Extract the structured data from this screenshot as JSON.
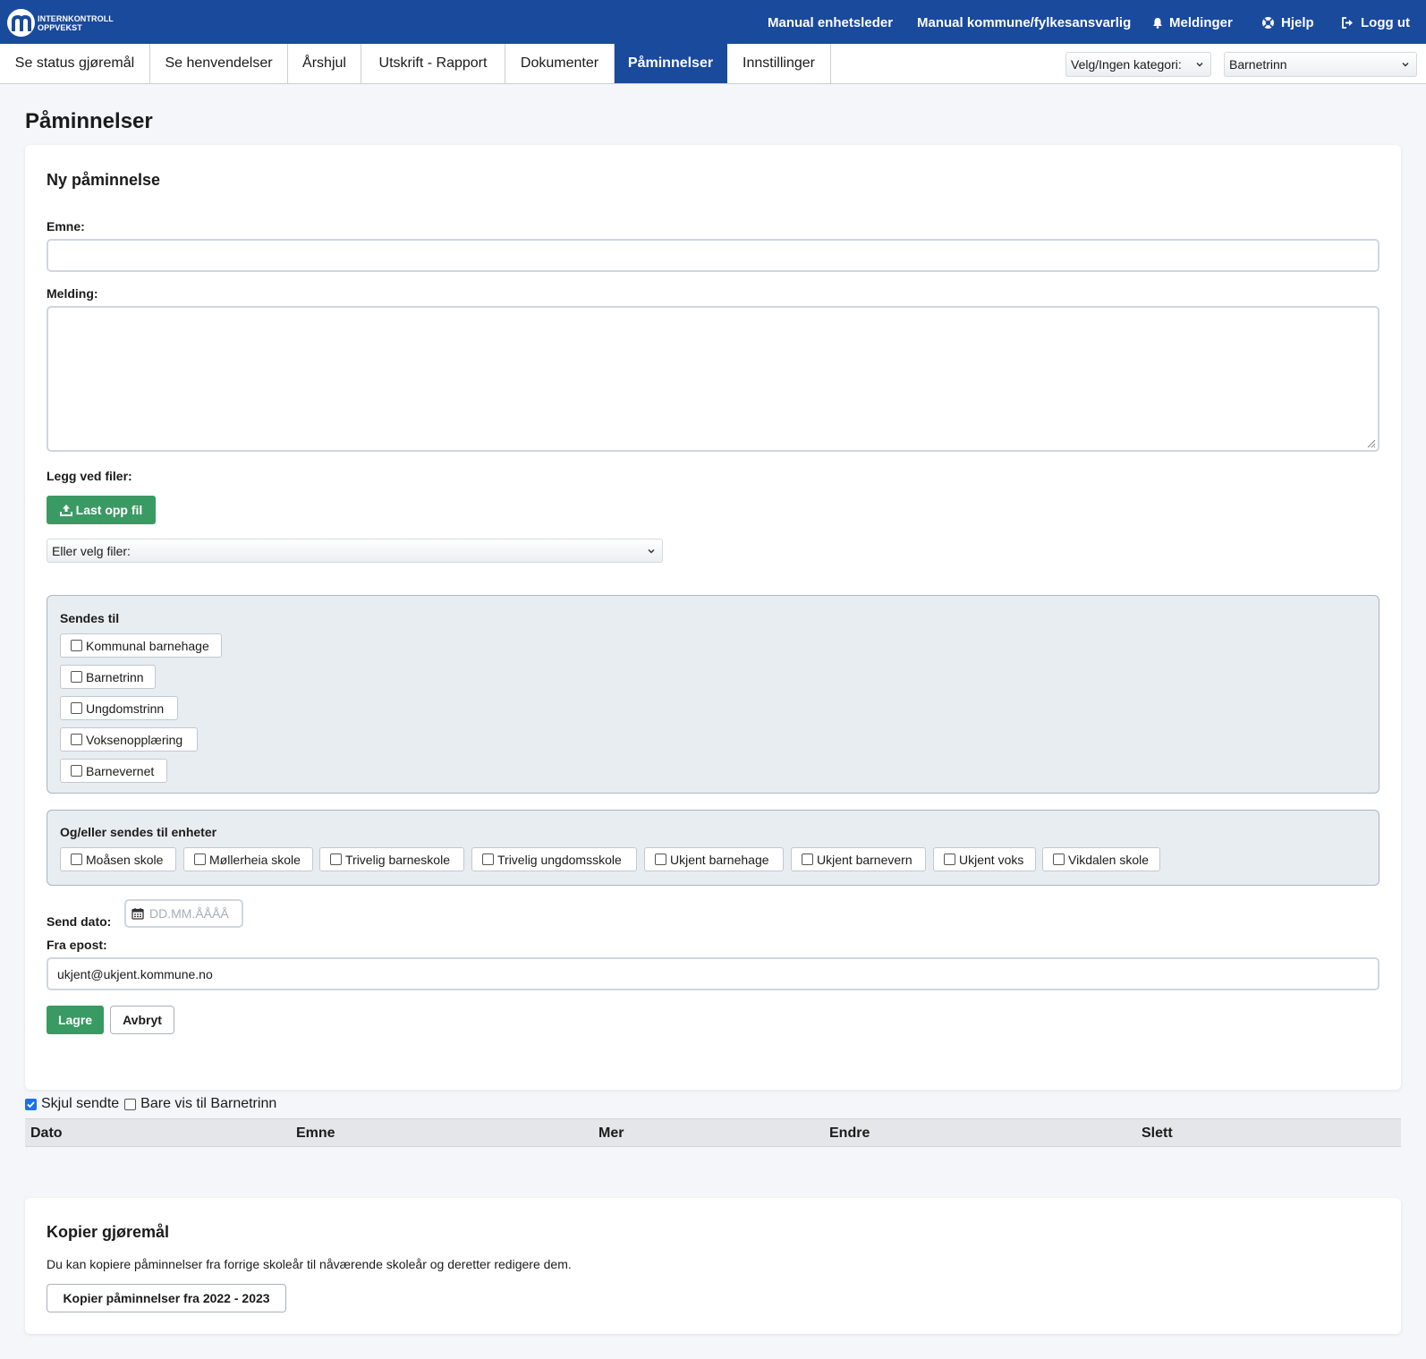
{
  "brand": {
    "line1": "INTERNKONTROLL",
    "line2": "OPPVEKST"
  },
  "topnav": {
    "manual_enhet": "Manual enhetsleder",
    "manual_kommune": "Manual kommune/fylkesansvarlig",
    "meldinger": "Meldinger",
    "hjelp": "Hjelp",
    "logg_ut": "Logg ut"
  },
  "tabs": [
    "Se status gjøremål",
    "Se henvendelser",
    "Årshjul",
    "Utskrift - Rapport",
    "Dokumenter",
    "Påminnelser",
    "Innstillinger"
  ],
  "active_tab": "Påminnelser",
  "filters": {
    "kategori": "Velg/Ingen kategori:",
    "trinn": "Barnetrinn"
  },
  "page_title": "Påminnelser",
  "form": {
    "title": "Ny påminnelse",
    "emne_label": "Emne:",
    "emne_value": "",
    "melding_label": "Melding:",
    "melding_value": "",
    "filer_label": "Legg ved filer:",
    "upload_button": "Last opp fil",
    "velg_filer": "Eller velg filer:",
    "sendes_til_title": "Sendes til",
    "sendes_til": [
      "Kommunal barnehage",
      "Barnetrinn",
      "Ungdomstrinn",
      "Voksenopplæring",
      "Barnevernet"
    ],
    "enheter_title": "Og/eller sendes til enheter",
    "enheter": [
      "Moåsen skole",
      "Møllerheia skole",
      "Trivelig barneskole",
      "Trivelig ungdomsskole",
      "Ukjent barnehage",
      "Ukjent barnevern",
      "Ukjent voks",
      "Vikdalen skole"
    ],
    "send_dato_label": "Send dato:",
    "send_dato_placeholder": "DD.MM.ÅÅÅÅ",
    "fra_epost_label": "Fra epost:",
    "fra_epost_value": "ukjent@ukjent.kommune.no",
    "lagre": "Lagre",
    "avbryt": "Avbryt"
  },
  "list": {
    "skjul_sendte": "Skjul sendte",
    "skjul_sendte_checked": true,
    "bare_vis": "Bare vis til Barnetrinn",
    "bare_vis_checked": false,
    "columns": [
      "Dato",
      "Emne",
      "Mer",
      "Endre",
      "Slett"
    ]
  },
  "kopier": {
    "title": "Kopier gjøremål",
    "text": "Du kan kopiere påminnelser fra forrige skoleår til nåværende skoleår og deretter redigere dem.",
    "button": "Kopier påminnelser fra 2022 - 2023"
  },
  "colors": {
    "primary": "#1a4a9c",
    "success": "#3a9a63",
    "background": "#f4f6f9"
  }
}
